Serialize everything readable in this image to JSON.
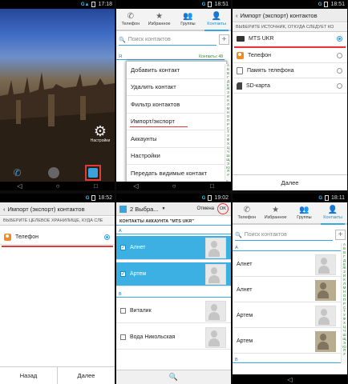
{
  "s1": {
    "time": "17:18",
    "settings_label": "Настройки"
  },
  "s2": {
    "time": "18:51",
    "tabs": [
      "Телефон",
      "Избранное",
      "Группы",
      "Контакты"
    ],
    "search_placeholder": "Поиск контактов",
    "section_letter": "Я",
    "contacts_count": "Контакты: 48",
    "menu": [
      "Добавить контакт",
      "Удалить контакт",
      "Фильтр контактов",
      "Импорт/экспорт",
      "Аккаунты",
      "Настройки",
      "Передать видимые контакт"
    ],
    "side_letters": [
      "Р",
      "В",
      "Д"
    ]
  },
  "s3": {
    "time": "18:51",
    "title": "Импорт (экспорт) контактов",
    "subtitle": "ВЫБЕРИТЕ ИСТОЧНИК, ОТКУДА СЛЕДУЕТ КО",
    "options": [
      "MTS UKR",
      "Телефон",
      "Память телефона",
      "SD-карта"
    ],
    "next": "Далее"
  },
  "s4": {
    "time": "18:52",
    "title": "Импорт (экспорт) контактов",
    "subtitle": "ВЫБЕРИТЕ ЦЕЛЕВОЕ ХРАНИЛИЩЕ, КУДА СЛЕ",
    "option": "Телефон",
    "back": "Назад",
    "next": "Далее"
  },
  "s5": {
    "time": "19:02",
    "selected": "2 Выбра...",
    "cancel": "Отмена",
    "ok": "OK",
    "account_header": "КОНТАКТЫ АККАУНТА \"MTS UKR\"",
    "letter_a": "А",
    "letter_b": "В",
    "contacts": [
      "Алнет",
      "Артем",
      "Виталик",
      "Вода Никольская"
    ]
  },
  "s6": {
    "time": "18:11",
    "tabs": [
      "Телефон",
      "Избранное",
      "Группы",
      "Контакты"
    ],
    "search_placeholder": "Поиск контактов",
    "letter_a": "А",
    "letter_b": "В",
    "contacts": [
      "Алнет",
      "Алнет",
      "Артем",
      "Артем"
    ]
  },
  "colors": {
    "accent": "#37a8e0",
    "selection": "#3cb0e2",
    "highlight": "#e23a3a"
  }
}
